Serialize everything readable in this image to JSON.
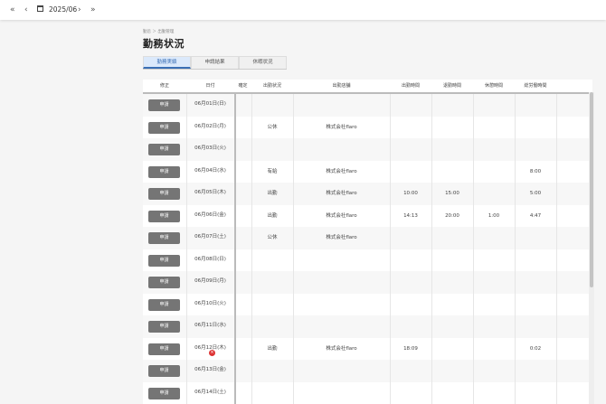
{
  "toolbar": {
    "first_icon": "«",
    "prev_icon": "‹",
    "current_month": "2025/06",
    "next_icon": "›",
    "last_icon": "»"
  },
  "breadcrumb": "勤怠 ＞ 出勤管理",
  "page_title": "勤務状況",
  "tabs": [
    {
      "label": "勤務実績",
      "active": true
    },
    {
      "label": "申請結果",
      "active": false
    },
    {
      "label": "休暇状況",
      "active": false
    }
  ],
  "table": {
    "headers": [
      "修正",
      "日付",
      "確定",
      "出勤状況",
      "出勤店舗",
      "出勤時間",
      "退勤時間",
      "休憩時間",
      "総労働時間"
    ],
    "apply_label": "申請",
    "rows": [
      {
        "date": "06月01日(日)",
        "confirmed": "",
        "status": "",
        "store": "",
        "start": "",
        "end": "",
        "break": "",
        "total": ""
      },
      {
        "date": "06月02日(月)",
        "confirmed": "",
        "status": "公休",
        "store": "株式会社flaro",
        "start": "",
        "end": "",
        "break": "",
        "total": ""
      },
      {
        "date": "06月03日(火)",
        "confirmed": "",
        "status": "",
        "store": "",
        "start": "",
        "end": "",
        "break": "",
        "total": ""
      },
      {
        "date": "06月04日(水)",
        "confirmed": "",
        "status": "有給",
        "store": "株式会社flaro",
        "start": "",
        "end": "",
        "break": "",
        "total": "8:00"
      },
      {
        "date": "06月05日(木)",
        "confirmed": "",
        "status": "出勤",
        "store": "株式会社flaro",
        "start": "10:00",
        "end": "15:00",
        "break": "",
        "total": "5:00"
      },
      {
        "date": "06月06日(金)",
        "confirmed": "",
        "status": "出勤",
        "store": "株式会社flaro",
        "start": "14:13",
        "end": "20:00",
        "break": "1:00",
        "total": "4:47"
      },
      {
        "date": "06月07日(土)",
        "confirmed": "",
        "status": "公休",
        "store": "株式会社flaro",
        "start": "",
        "end": "",
        "break": "",
        "total": ""
      },
      {
        "date": "06月08日(日)",
        "confirmed": "",
        "status": "",
        "store": "",
        "start": "",
        "end": "",
        "break": "",
        "total": ""
      },
      {
        "date": "06月09日(月)",
        "confirmed": "",
        "status": "",
        "store": "",
        "start": "",
        "end": "",
        "break": "",
        "total": ""
      },
      {
        "date": "06月10日(火)",
        "confirmed": "",
        "status": "",
        "store": "",
        "start": "",
        "end": "",
        "break": "",
        "total": ""
      },
      {
        "date": "06月11日(水)",
        "confirmed": "",
        "status": "",
        "store": "",
        "start": "",
        "end": "",
        "break": "",
        "total": ""
      },
      {
        "date": "06月12日(木)",
        "confirmed": "",
        "status": "出勤",
        "store": "株式会社flaro",
        "start": "18:09",
        "end": "",
        "break": "",
        "total": "0:02",
        "error": true
      },
      {
        "date": "06月13日(金)",
        "confirmed": "",
        "status": "",
        "store": "",
        "start": "",
        "end": "",
        "break": "",
        "total": ""
      },
      {
        "date": "06月14日(土)",
        "confirmed": "",
        "status": "",
        "store": "",
        "start": "",
        "end": "",
        "break": "",
        "total": ""
      }
    ]
  },
  "colors": {
    "accent": "#3a6fb5",
    "apply_button": "#757575",
    "error": "#dd3333"
  },
  "icons": {
    "first": "double-chevron-left-icon",
    "prev": "chevron-left-icon",
    "calendar": "calendar-icon",
    "next": "chevron-right-icon",
    "last": "double-chevron-right-icon",
    "error": "error-circle-icon"
  }
}
